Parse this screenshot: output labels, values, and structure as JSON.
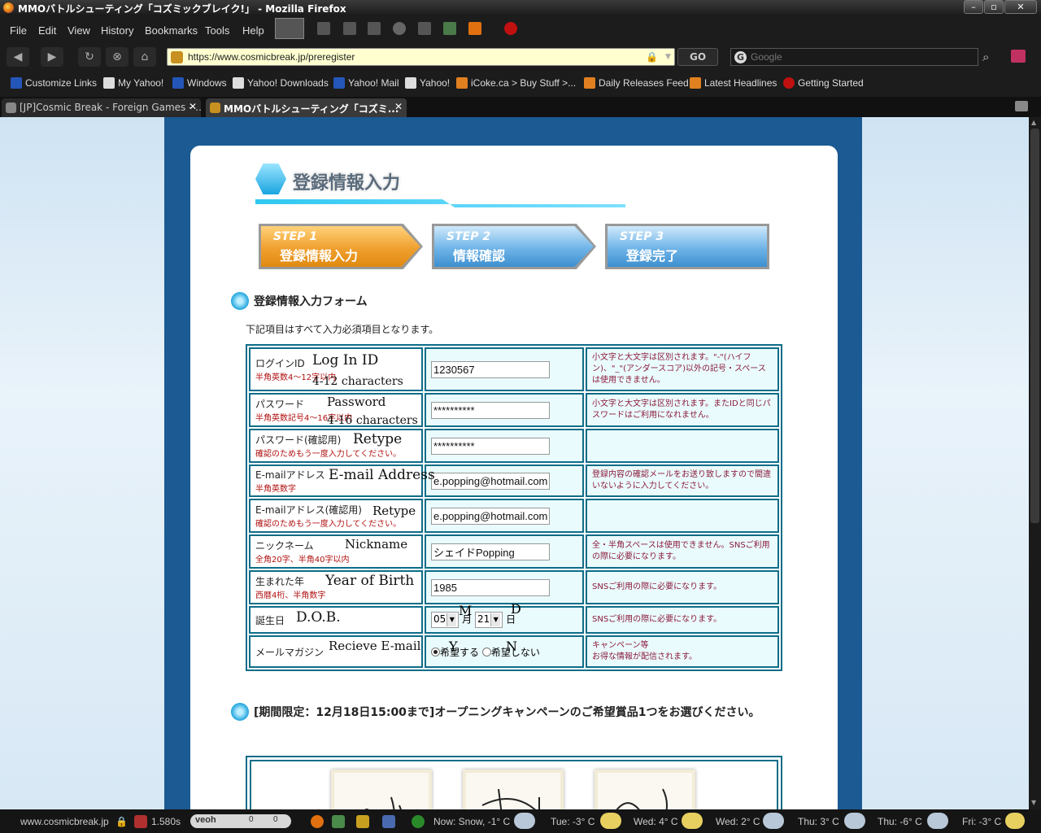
{
  "window": {
    "title": "MMOバトルシューティング「コズミックブレイク!」 - Mozilla Firefox",
    "min": "–",
    "max": "▫",
    "close": "✕"
  },
  "menu": [
    "File",
    "Edit",
    "View",
    "History",
    "Bookmarks",
    "Tools",
    "Help"
  ],
  "nav": {
    "url": "https://www.cosmicbreak.jp/preregister",
    "go": "GO",
    "search_placeholder": "Google"
  },
  "bookmarks": [
    "Customize Links",
    "My Yahoo!",
    "Windows",
    "Yahoo! Downloads",
    "Yahoo! Mail",
    "Yahoo!",
    "iCoke.ca > Buy Stuff >...",
    "Daily Releases Feed",
    "Latest Headlines",
    "Getting Started"
  ],
  "tabs": [
    {
      "label": "[JP]Cosmic Break - Foreign Games - ...",
      "close": "✕"
    },
    {
      "label": "MMOバトルシューティング「コズミ...",
      "close": "✕"
    }
  ],
  "page": {
    "heading": "登録情報入力",
    "steps": [
      {
        "l1": "STEP 1",
        "l2": "登録情報入力"
      },
      {
        "l1": "STEP 2",
        "l2": "情報確認"
      },
      {
        "l1": "STEP 3",
        "l2": "登録完了"
      }
    ],
    "form_title": "登録情報入力フォーム",
    "required_note": "下記項目はすべて入力必須項目となります。",
    "rows": [
      {
        "label": "ログインID",
        "sub": "半角英数4～12字以内",
        "hw": "Log In ID",
        "hw2": "4-12 characters",
        "value": "1230567",
        "note": "小文字と大文字は区別されます。\"-\"(ハイフン)、\"_\"(アンダースコア)以外の記号・スペースは使用できません。"
      },
      {
        "label": "パスワード",
        "sub": "半角英数記号4～16字以内",
        "hw": "Password",
        "hw2": "4-16 characters",
        "value": "**********",
        "note": "小文字と大文字は区別されます。またIDと同じパスワードはご利用になれません。"
      },
      {
        "label": "パスワード(確認用)",
        "sub": "確認のためもう一度入力してください。",
        "hw": "Retype",
        "value": "**********",
        "note": ""
      },
      {
        "label": "E-mailアドレス",
        "sub": "半角英数字",
        "hw": "E-mail Address",
        "value": "e.popping@hotmail.com",
        "note": "登録内容の確認メールをお送り致しますので間違いないように入力してください。"
      },
      {
        "label": "E-mailアドレス(確認用)",
        "sub": "確認のためもう一度入力してください。",
        "hw": "Retype",
        "value": "e.popping@hotmail.com",
        "note": ""
      },
      {
        "label": "ニックネーム",
        "sub": "全角20字、半角40字以内",
        "hw": "Nickname",
        "value": "シェイドPopping",
        "note": "全・半角スペースは使用できません。SNSご利用の際に必要になります。"
      },
      {
        "label": "生まれた年",
        "sub": "西暦4桁、半角数字",
        "hw": "Year of Birth",
        "value": "1985",
        "note": "SNSご利用の際に必要になります。"
      },
      {
        "label": "誕生日",
        "sub": "",
        "hw": "D.O.B.",
        "note": "SNSご利用の際に必要になります。"
      },
      {
        "label": "メールマガジン",
        "sub": "",
        "hw": "Recieve E-mail",
        "note": "キャンペーン等\nお得な情報が配信されます。"
      }
    ],
    "dob": {
      "month": "05",
      "month_unit": "月",
      "day": "21",
      "day_unit": "日",
      "hw_m": "M",
      "hw_d": "D"
    },
    "mail": {
      "yes": "希望する",
      "no": "希望しない",
      "hw_y": "Y",
      "hw_n": "N"
    },
    "campaign_title": "[期間限定：12月18日15:00まで]オープニングキャンペーンのご希望賞品1つをお選びください。"
  },
  "status": {
    "host": "www.cosmicbreak.jp",
    "time": "1.580s",
    "veoh": "veoh",
    "veoh_count1": "0",
    "veoh_count2": "0",
    "weather": [
      "Now: Snow, -1° C",
      "Tue: -3° C",
      "Wed: 4° C",
      "Wed: 2° C",
      "Thu: 3° C",
      "Thu: -6° C",
      "Fri: -3° C"
    ]
  }
}
